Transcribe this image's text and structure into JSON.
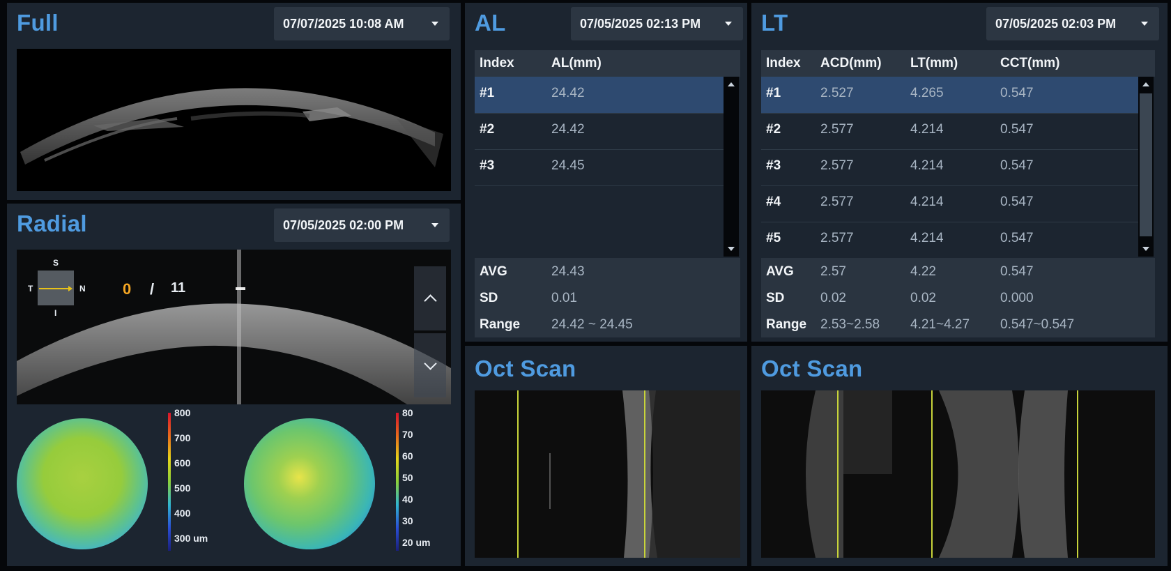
{
  "full": {
    "title": "Full",
    "date": "07/07/2025 10:08 AM"
  },
  "radial": {
    "title": "Radial",
    "date": "07/05/2025 02:00 PM",
    "orientation": {
      "s": "S",
      "t": "T",
      "n": "N",
      "i": "I"
    },
    "current": "0",
    "sep": "/",
    "total": "11",
    "map1_scale": [
      "800",
      "700",
      "600",
      "500",
      "400",
      "300 um"
    ],
    "map2_scale": [
      "80",
      "70",
      "60",
      "50",
      "40",
      "30",
      "20 um"
    ]
  },
  "al": {
    "title": "AL",
    "date": "07/05/2025 02:13 PM",
    "headers": [
      "Index",
      "AL(mm)"
    ],
    "rows": [
      {
        "index": "#1",
        "al": "24.42"
      },
      {
        "index": "#2",
        "al": "24.42"
      },
      {
        "index": "#3",
        "al": "24.45"
      }
    ],
    "summary": [
      {
        "label": "AVG",
        "v1": "24.43"
      },
      {
        "label": "SD",
        "v1": "0.01"
      },
      {
        "label": "Range",
        "v1": "24.42 ~ 24.45"
      }
    ]
  },
  "lt": {
    "title": "LT",
    "date": "07/05/2025 02:03 PM",
    "headers": [
      "Index",
      "ACD(mm)",
      "LT(mm)",
      "CCT(mm)"
    ],
    "rows": [
      {
        "index": "#1",
        "acd": "2.527",
        "lt": "4.265",
        "cct": "0.547"
      },
      {
        "index": "#2",
        "acd": "2.577",
        "lt": "4.214",
        "cct": "0.547"
      },
      {
        "index": "#3",
        "acd": "2.577",
        "lt": "4.214",
        "cct": "0.547"
      },
      {
        "index": "#4",
        "acd": "2.577",
        "lt": "4.214",
        "cct": "0.547"
      },
      {
        "index": "#5",
        "acd": "2.577",
        "lt": "4.214",
        "cct": "0.547"
      }
    ],
    "summary": [
      {
        "label": "AVG",
        "v1": "2.57",
        "v2": "4.22",
        "v3": "0.547"
      },
      {
        "label": "SD",
        "v1": "0.02",
        "v2": "0.02",
        "v3": "0.000"
      },
      {
        "label": "Range",
        "v1": "2.53~2.58",
        "v2": "4.21~4.27",
        "v3": "0.547~0.547"
      }
    ]
  },
  "oct1": {
    "title": "Oct Scan"
  },
  "oct2": {
    "title": "Oct Scan"
  },
  "colors": {
    "accent": "#4f9be0",
    "panel": "#1c2530",
    "selected_row": "#2e4a70",
    "index_orange": "#f5a623",
    "scan_line": "#c8d43a"
  }
}
